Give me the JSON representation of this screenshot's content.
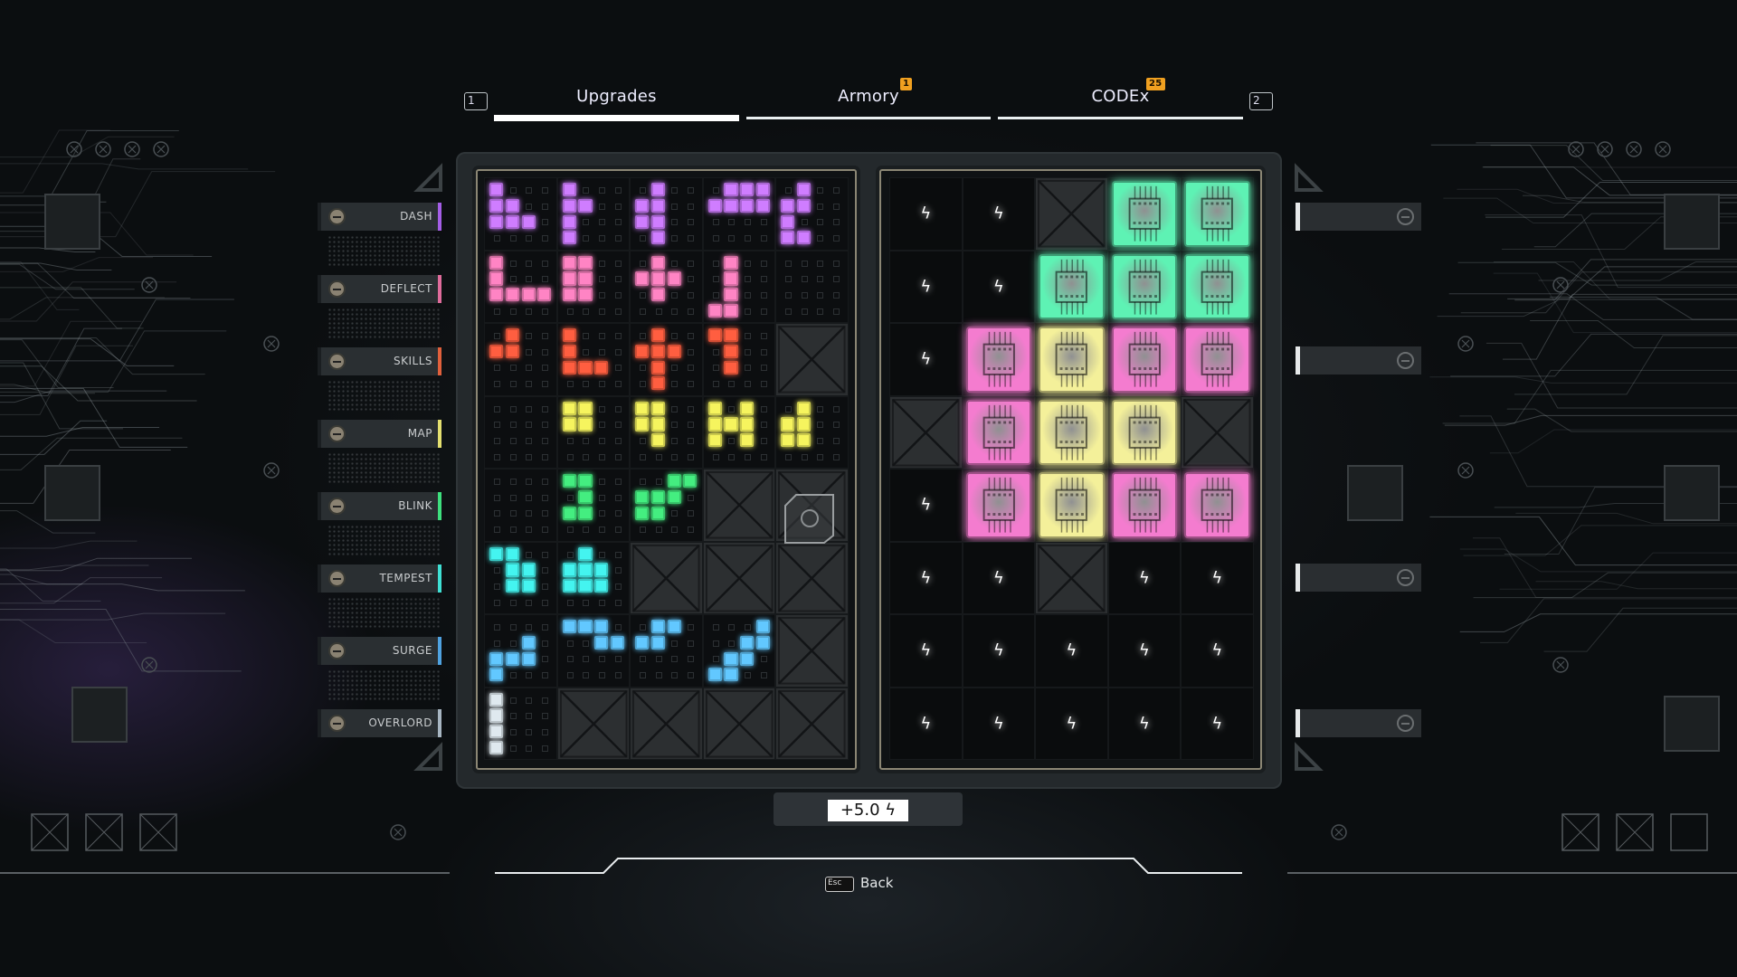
{
  "tabs": {
    "prev_key": "1",
    "next_key": "2",
    "items": [
      {
        "label": "Upgrades",
        "active": true,
        "badge": null
      },
      {
        "label": "Armory",
        "active": false,
        "badge": "1"
      },
      {
        "label": "CODEx",
        "active": false,
        "badge": "25"
      }
    ]
  },
  "categories": [
    {
      "label": "DASH",
      "color": "#a45ee6"
    },
    {
      "label": "DEFLECT",
      "color": "#e06c9c"
    },
    {
      "label": "SKILLS",
      "color": "#e0603c"
    },
    {
      "label": "MAP",
      "color": "#e4e070"
    },
    {
      "label": "BLINK",
      "color": "#3ee07e"
    },
    {
      "label": "TEMPEST",
      "color": "#3fe0d4"
    },
    {
      "label": "SURGE",
      "color": "#4fa2e0"
    },
    {
      "label": "OVERLORD",
      "color": "#a8b6c2"
    }
  ],
  "right_slots": 4,
  "piece_colors": {
    "purple": "#cf7dff",
    "pink": "#ff84c4",
    "orange": "#ff5e40",
    "yellow": "#f6f45e",
    "green": "#44ee80",
    "cyan": "#44f4f0",
    "blue": "#62c8ff",
    "white": "#dfe9ef"
  },
  "inventory": [
    [
      {
        "state": "piece",
        "color": "purple",
        "shape": [
          "X...",
          "XX..",
          "XXX.",
          "...."
        ]
      },
      {
        "state": "piece",
        "color": "purple",
        "shape": [
          "X...",
          "XX..",
          "X...",
          "X..."
        ]
      },
      {
        "state": "piece",
        "color": "purple",
        "shape": [
          ".X..",
          "XX..",
          "XX..",
          ".X.."
        ]
      },
      {
        "state": "piece",
        "color": "purple",
        "shape": [
          ".XXX",
          "XXXX",
          "....",
          "...."
        ]
      },
      {
        "state": "piece",
        "color": "purple",
        "shape": [
          ".X..",
          "XX..",
          "X...",
          "XX.."
        ]
      }
    ],
    [
      {
        "state": "piece",
        "color": "pink",
        "shape": [
          "X...",
          "X...",
          "XXXX",
          "...."
        ]
      },
      {
        "state": "piece",
        "color": "pink",
        "shape": [
          "XX..",
          "XX..",
          "XX..",
          "...."
        ]
      },
      {
        "state": "piece",
        "color": "pink",
        "shape": [
          ".X..",
          "XXX.",
          ".X..",
          "...."
        ]
      },
      {
        "state": "piece",
        "color": "pink",
        "shape": [
          ".X..",
          ".X..",
          ".X..",
          "XX.."
        ]
      },
      {
        "state": "empty"
      }
    ],
    [
      {
        "state": "piece",
        "color": "orange",
        "shape": [
          ".X..",
          "XX..",
          "....",
          "...."
        ]
      },
      {
        "state": "piece",
        "color": "orange",
        "shape": [
          "X...",
          "X...",
          "XXX.",
          "...."
        ]
      },
      {
        "state": "piece",
        "color": "orange",
        "shape": [
          ".X..",
          "XXX.",
          ".X..",
          ".X.."
        ]
      },
      {
        "state": "piece",
        "color": "orange",
        "shape": [
          "XX..",
          ".X..",
          ".X..",
          "...."
        ]
      },
      {
        "state": "locked"
      }
    ],
    [
      {
        "state": "empty"
      },
      {
        "state": "piece",
        "color": "yellow",
        "shape": [
          "XX..",
          "XX..",
          "....",
          "...."
        ]
      },
      {
        "state": "piece",
        "color": "yellow",
        "shape": [
          "XX..",
          "XX..",
          ".X..",
          "...."
        ]
      },
      {
        "state": "piece",
        "color": "yellow",
        "shape": [
          "X.X.",
          "XXX.",
          "X.X.",
          "...."
        ]
      },
      {
        "state": "piece",
        "color": "yellow",
        "shape": [
          ".X..",
          "XX..",
          "XX..",
          "...."
        ]
      }
    ],
    [
      {
        "state": "empty"
      },
      {
        "state": "piece",
        "color": "green",
        "shape": [
          "XX..",
          ".X..",
          "XX..",
          "...."
        ]
      },
      {
        "state": "piece",
        "color": "green",
        "shape": [
          "..XX",
          "XXX.",
          "XX..",
          "...."
        ]
      },
      {
        "state": "locked"
      },
      {
        "state": "locked-special"
      }
    ],
    [
      {
        "state": "piece",
        "color": "cyan",
        "shape": [
          "XX..",
          ".XX.",
          ".XX.",
          "...."
        ]
      },
      {
        "state": "piece",
        "color": "cyan",
        "shape": [
          ".X..",
          "XXX.",
          "XXX.",
          "...."
        ]
      },
      {
        "state": "locked"
      },
      {
        "state": "locked"
      },
      {
        "state": "locked"
      }
    ],
    [
      {
        "state": "piece",
        "color": "blue",
        "shape": [
          "....",
          "..X.",
          "XXX.",
          "X..."
        ]
      },
      {
        "state": "piece",
        "color": "blue",
        "shape": [
          "XXX.",
          "..XX",
          "....",
          "...."
        ]
      },
      {
        "state": "piece",
        "color": "blue",
        "shape": [
          ".XX.",
          "XX..",
          "....",
          "...."
        ]
      },
      {
        "state": "piece",
        "color": "blue",
        "shape": [
          "...X",
          "..XX",
          ".XX.",
          "XX.."
        ]
      },
      {
        "state": "locked"
      }
    ],
    [
      {
        "state": "piece",
        "color": "white",
        "shape": [
          "X...",
          "X...",
          "X...",
          "X..."
        ]
      },
      {
        "state": "locked"
      },
      {
        "state": "locked"
      },
      {
        "state": "locked"
      },
      {
        "state": "locked"
      }
    ]
  ],
  "board_colors": {
    "green": "#5ef2b4",
    "pink": "#f47ccf",
    "yellow": "#f4f09a"
  },
  "board": [
    [
      "bolt",
      "bolt",
      "locked",
      "green",
      "green"
    ],
    [
      "bolt",
      "bolt",
      "green",
      "green",
      "green"
    ],
    [
      "bolt",
      "pink",
      "yellow",
      "pink",
      "pink"
    ],
    [
      "locked",
      "pink",
      "yellow",
      "yellow",
      "locked"
    ],
    [
      "bolt",
      "pink",
      "yellow",
      "pink",
      "pink"
    ],
    [
      "bolt",
      "bolt",
      "locked",
      "bolt",
      "bolt"
    ],
    [
      "bolt",
      "bolt",
      "bolt",
      "bolt",
      "bolt"
    ],
    [
      "bolt",
      "bolt",
      "bolt",
      "bolt",
      "bolt"
    ]
  ],
  "energy": {
    "value": "+5.0",
    "icon": "lightning-bolt-icon"
  },
  "footer": {
    "key": "Esc",
    "label": "Back"
  }
}
